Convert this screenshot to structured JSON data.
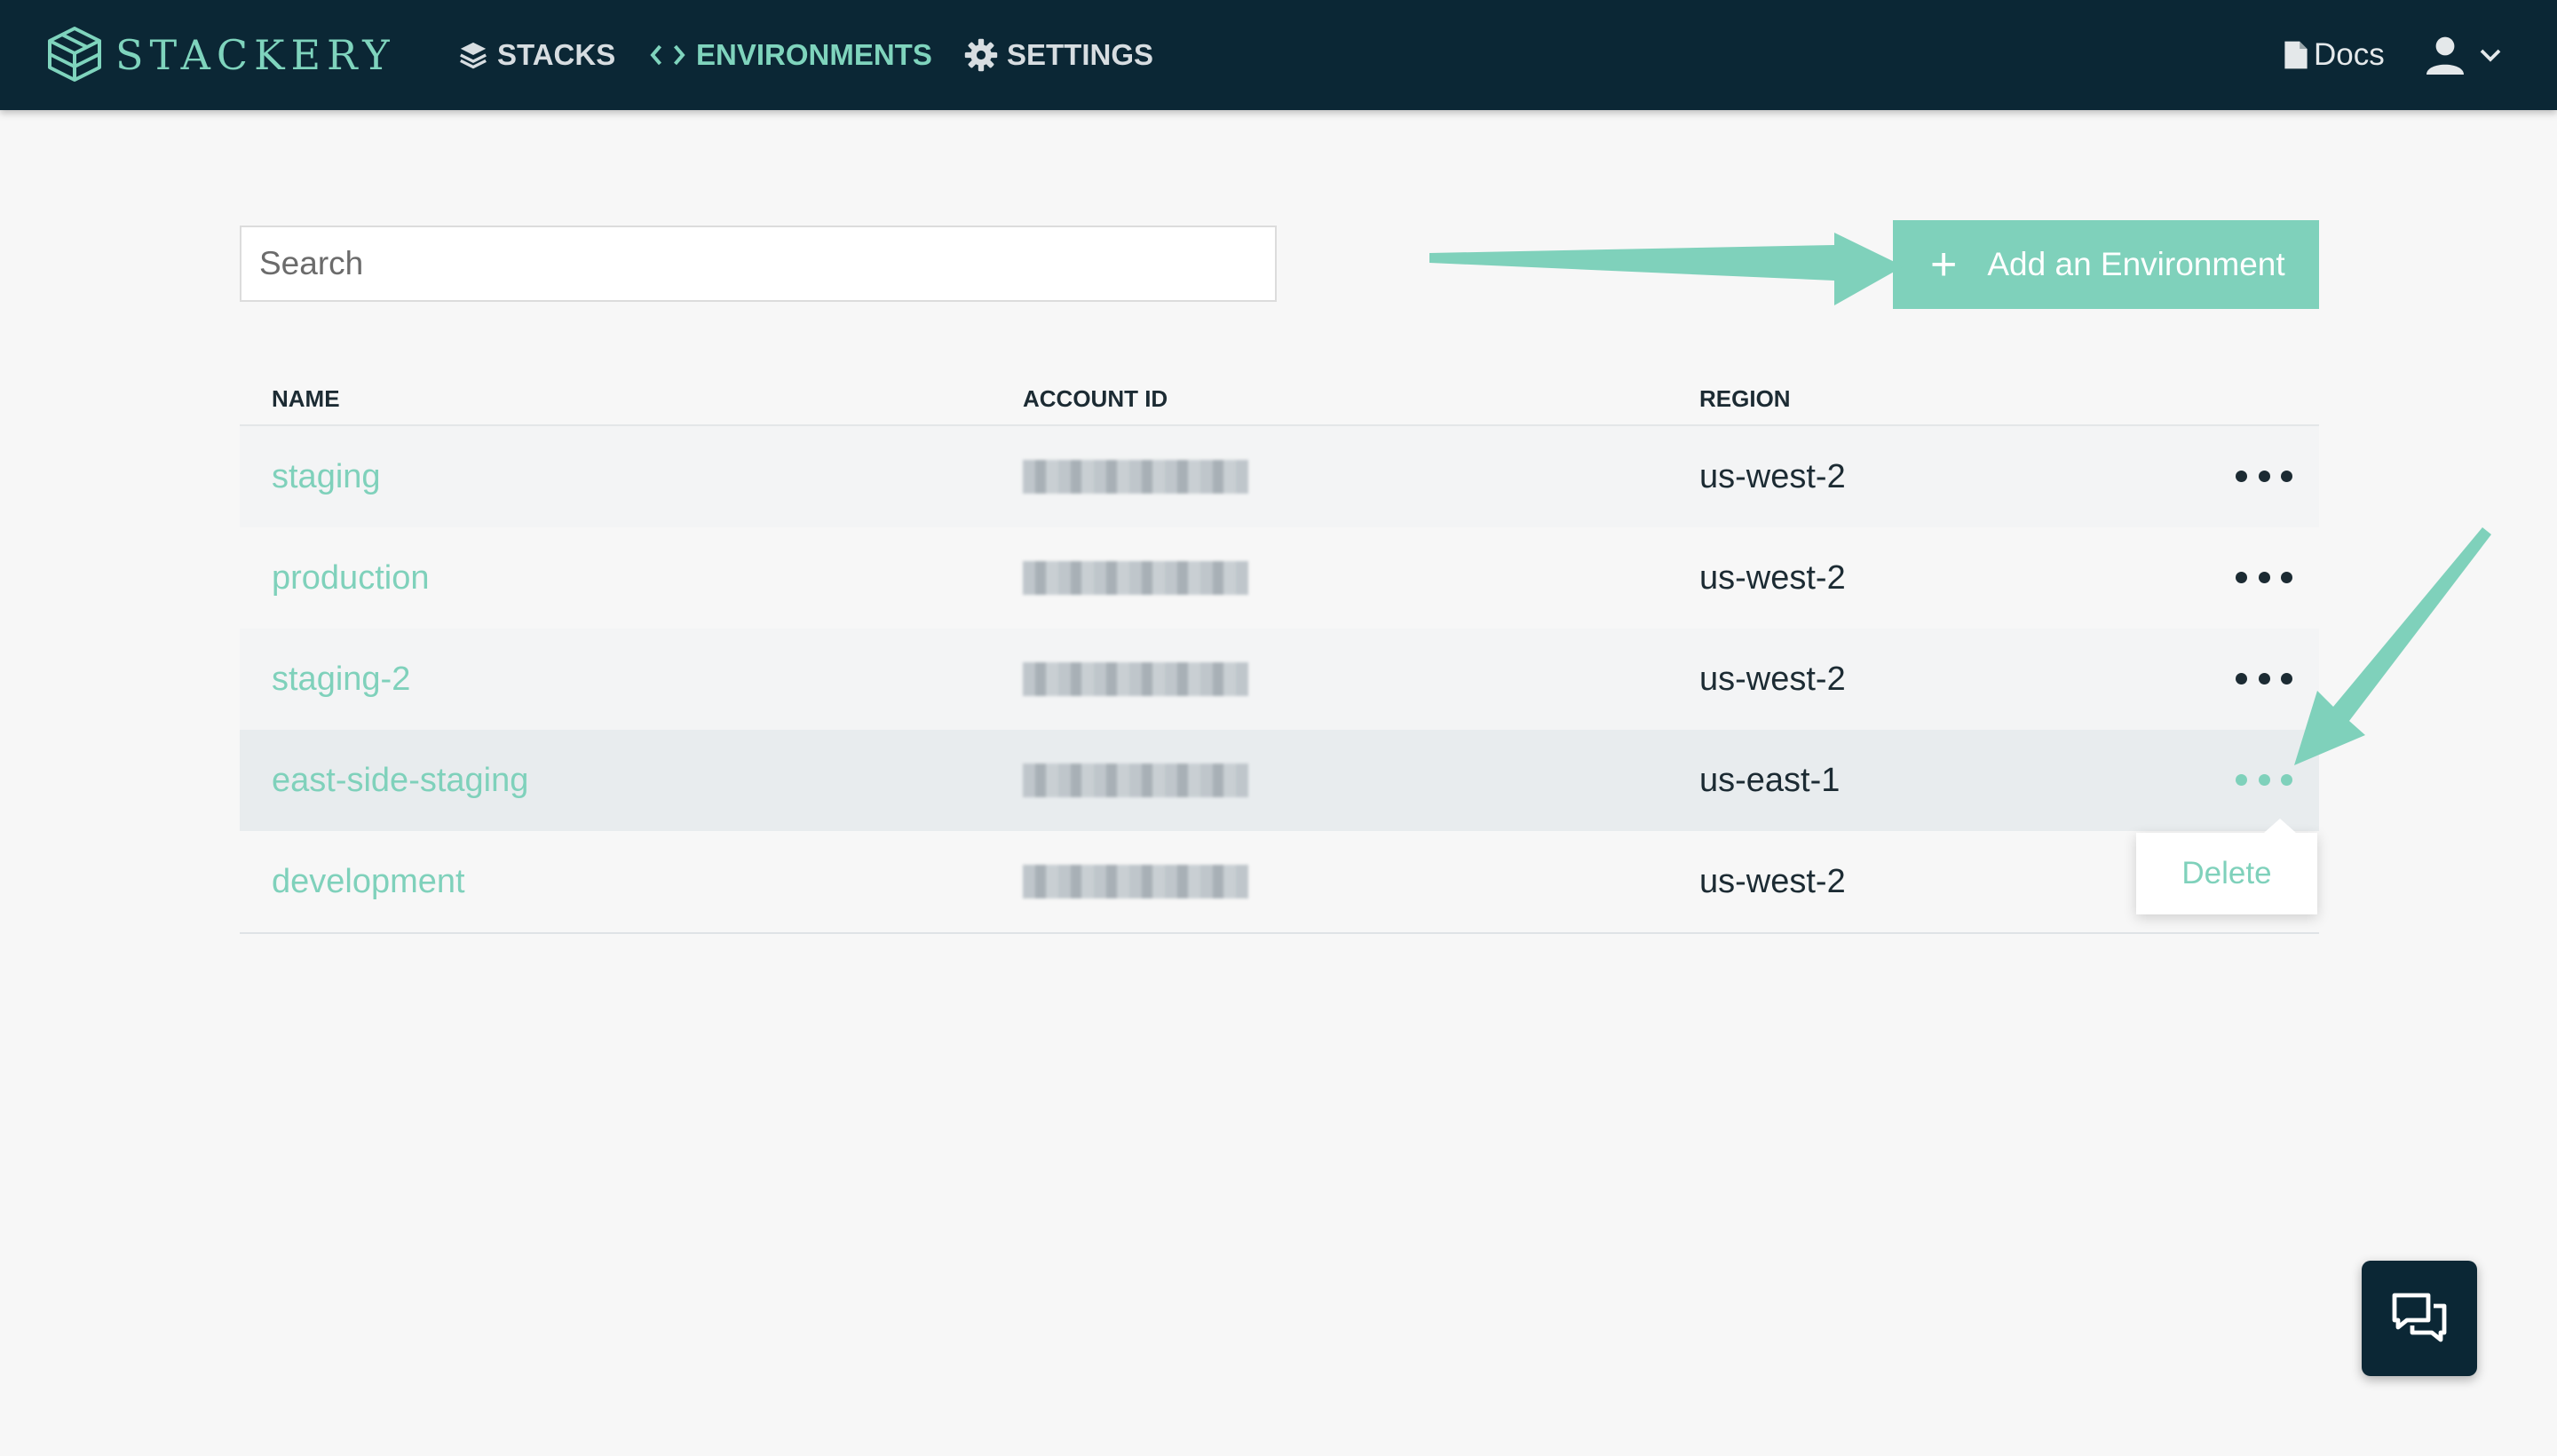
{
  "brand": {
    "name": "STACKERY"
  },
  "nav": {
    "stacks": "STACKS",
    "environments": "ENVIRONMENTS",
    "settings": "SETTINGS",
    "docs": "Docs"
  },
  "search": {
    "placeholder": "Search"
  },
  "add_button": {
    "label": "Add an Environment"
  },
  "table": {
    "headers": {
      "name": "NAME",
      "account_id": "ACCOUNT ID",
      "region": "REGION"
    },
    "rows": [
      {
        "name": "staging",
        "region": "us-west-2"
      },
      {
        "name": "production",
        "region": "us-west-2"
      },
      {
        "name": "staging-2",
        "region": "us-west-2"
      },
      {
        "name": "east-side-staging",
        "region": "us-east-1"
      },
      {
        "name": "development",
        "region": "us-west-2"
      }
    ]
  },
  "row_menu": {
    "delete": "Delete"
  },
  "colors": {
    "nav_bg": "#0b2735",
    "accent": "#7fd1bb",
    "page_bg": "#f7f7f7"
  }
}
